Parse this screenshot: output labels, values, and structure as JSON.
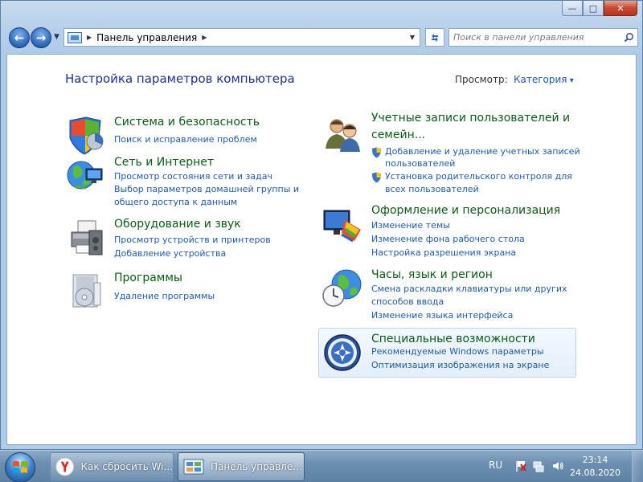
{
  "window": {
    "caption": {
      "minimize": "—",
      "maximize": "□",
      "close": "✕"
    }
  },
  "toolbar": {
    "back_icon": "arrow-left-icon",
    "forward_icon": "arrow-right-icon",
    "address": "Панель управления",
    "search_placeholder": "Поиск в панели управления"
  },
  "content": {
    "title": "Настройка параметров компьютера",
    "view_label": "Просмотр:",
    "view_value": "Категория"
  },
  "categories": {
    "system": {
      "title": "Система и безопасность",
      "links": [
        "Поиск и исправление проблем"
      ]
    },
    "network": {
      "title": "Сеть и Интернет",
      "links": [
        "Просмотр состояния сети и задач",
        "Выбор параметров домашней группы и",
        "общего доступа к данным"
      ]
    },
    "hardware": {
      "title": "Оборудование и звук",
      "links": [
        "Просмотр устройств и принтеров",
        "Добавление устройства"
      ]
    },
    "programs": {
      "title": "Программы",
      "links": [
        "Удаление программы"
      ]
    },
    "users": {
      "title_line1": "Учетные записи пользователей и",
      "title_line2": "семейн...",
      "links": [
        "Добавление и удаление учетных записей",
        "пользователей",
        "Установка родительского контроля для",
        "всех пользователей"
      ]
    },
    "appearance": {
      "title": "Оформление и персонализация",
      "links": [
        "Изменение темы",
        "Изменение фона рабочего стола",
        "Настройка разрешения экрана"
      ]
    },
    "clock": {
      "title": "Часы, язык и регион",
      "links": [
        "Смена раскладки клавиатуры или других",
        "способов ввода",
        "Изменение языка интерфейса"
      ]
    },
    "access": {
      "title": "Специальные возможности",
      "links": [
        "Рекомендуемые Windows параметры",
        "Оптимизация изображения на экране"
      ]
    }
  },
  "taskbar": {
    "items": [
      {
        "label": "Как сбросить Wi...",
        "icon": "yandex-browser-icon"
      },
      {
        "label": "Панель управле...",
        "icon": "control-panel-icon",
        "active": true
      }
    ],
    "lang": "RU",
    "time": "23:14",
    "date": "24.08.2020"
  },
  "colors": {
    "category_title": "#0c5a15",
    "link": "#1e5bb0",
    "page_title": "#1e3287"
  }
}
